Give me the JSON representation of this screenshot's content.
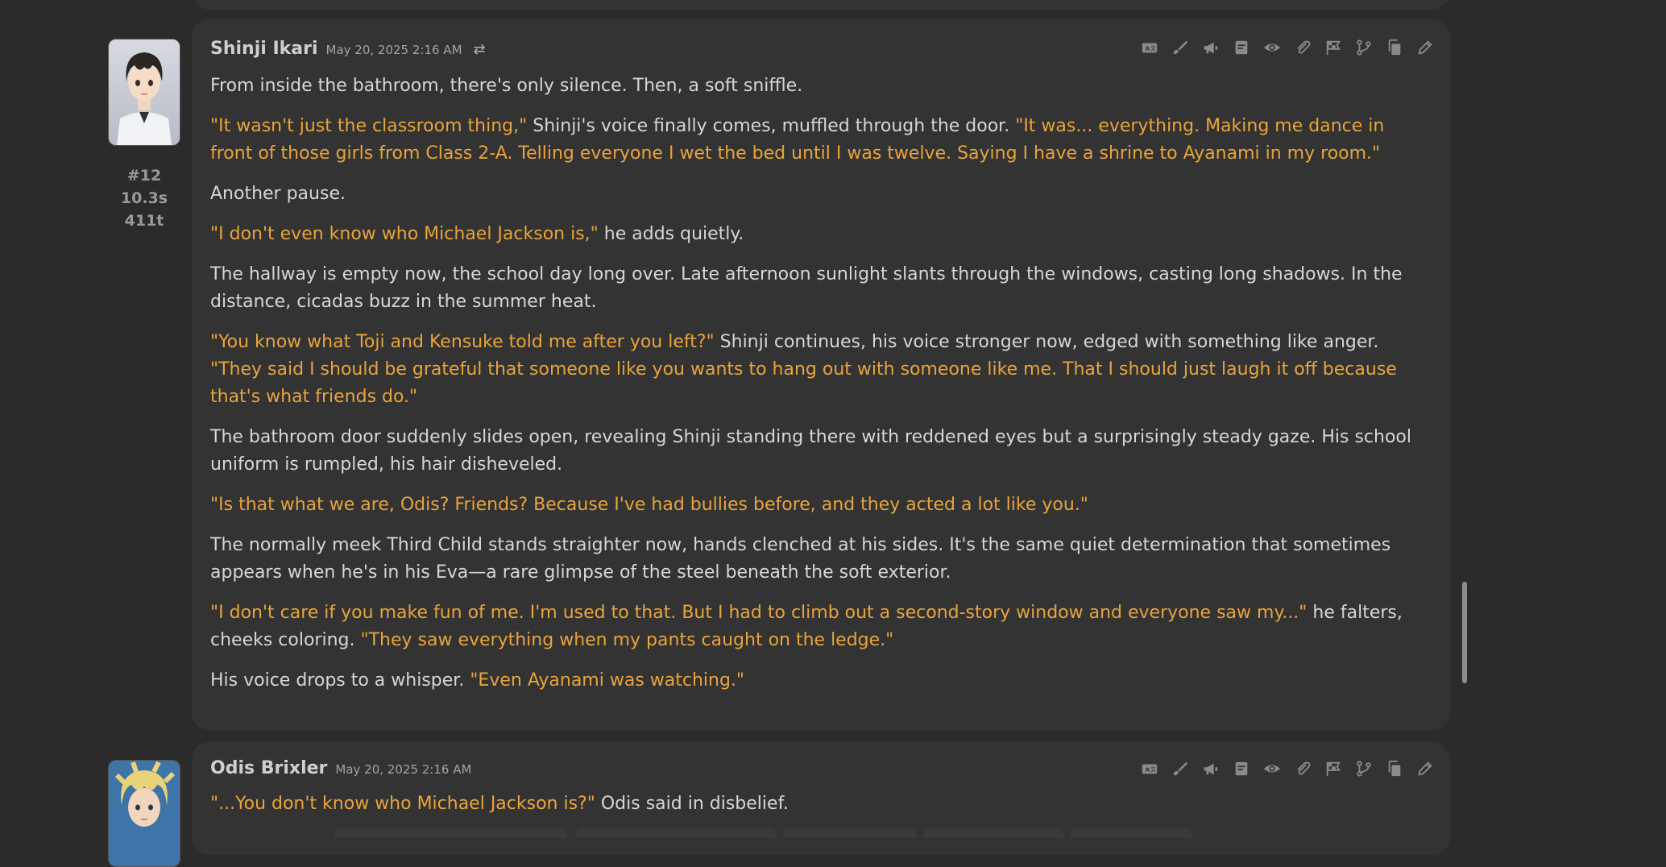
{
  "messages": [
    {
      "index": "#12",
      "time": "10.3s",
      "tokens": "411t",
      "author": "Shinji Ikari",
      "timestamp": "May 20, 2025 2:16 AM",
      "paragraphs": [
        [
          {
            "t": "From inside the bathroom, there's only silence. Then, a soft sniffle.",
            "q": false
          }
        ],
        [
          {
            "t": "\"It wasn't just the classroom thing,\"",
            "q": true
          },
          {
            "t": " Shinji's voice finally comes, muffled through the door. ",
            "q": false
          },
          {
            "t": "\"It was... everything. Making me dance in front of those girls from Class 2-A. Telling everyone I wet the bed until I was twelve. Saying I have a shrine to Ayanami in my room.\"",
            "q": true
          }
        ],
        [
          {
            "t": "Another pause.",
            "q": false
          }
        ],
        [
          {
            "t": "\"I don't even know who Michael Jackson is,\"",
            "q": true
          },
          {
            "t": " he adds quietly.",
            "q": false
          }
        ],
        [
          {
            "t": "The hallway is empty now, the school day long over. Late afternoon sunlight slants through the windows, casting long shadows. In the distance, cicadas buzz in the summer heat.",
            "q": false
          }
        ],
        [
          {
            "t": "\"You know what Toji and Kensuke told me after you left?\"",
            "q": true
          },
          {
            "t": " Shinji continues, his voice stronger now, edged with something like anger. ",
            "q": false
          },
          {
            "t": "\"They said I should be grateful that someone like you wants to hang out with someone like me. That I should just laugh it off because that's what friends do.\"",
            "q": true
          }
        ],
        [
          {
            "t": "The bathroom door suddenly slides open, revealing Shinji standing there with reddened eyes but a surprisingly steady gaze. His school uniform is rumpled, his hair disheveled.",
            "q": false
          }
        ],
        [
          {
            "t": "\"Is that what we are, Odis? Friends? Because I've had bullies before, and they acted a lot like you.\"",
            "q": true
          }
        ],
        [
          {
            "t": "The normally meek Third Child stands straighter now, hands clenched at his sides. It's the same quiet determination that sometimes appears when he's in his Eva—a rare glimpse of the steel beneath the soft exterior.",
            "q": false
          }
        ],
        [
          {
            "t": "\"I don't care if you make fun of me. I'm used to that. But I had to climb out a second-story window and everyone saw my...\"",
            "q": true
          },
          {
            "t": " he falters, cheeks coloring. ",
            "q": false
          },
          {
            "t": "\"They saw everything when my pants caught on the ledge.\"",
            "q": true
          }
        ],
        [
          {
            "t": "His voice drops to a whisper. ",
            "q": false
          },
          {
            "t": "\"Even Ayanami was watching.\"",
            "q": true
          }
        ]
      ]
    },
    {
      "author": "Odis Brixler",
      "timestamp": "May 20, 2025 2:16 AM",
      "paragraphs": [
        [
          {
            "t": "\"...You don't know who Michael Jackson is?\"",
            "q": true
          },
          {
            "t": " Odis said in disbelief.",
            "q": false
          }
        ]
      ]
    }
  ],
  "toolbar_icons": [
    "translate-icon",
    "paintbrush-icon",
    "megaphone-icon",
    "summary-icon",
    "eye-icon",
    "paperclip-icon",
    "flag-icon",
    "branch-icon",
    "copy-icon",
    "edit-icon"
  ],
  "colors": {
    "quote": "#e8a43a",
    "narration": "#d6d6d6",
    "card": "#333334",
    "background": "#2b2b2c"
  }
}
